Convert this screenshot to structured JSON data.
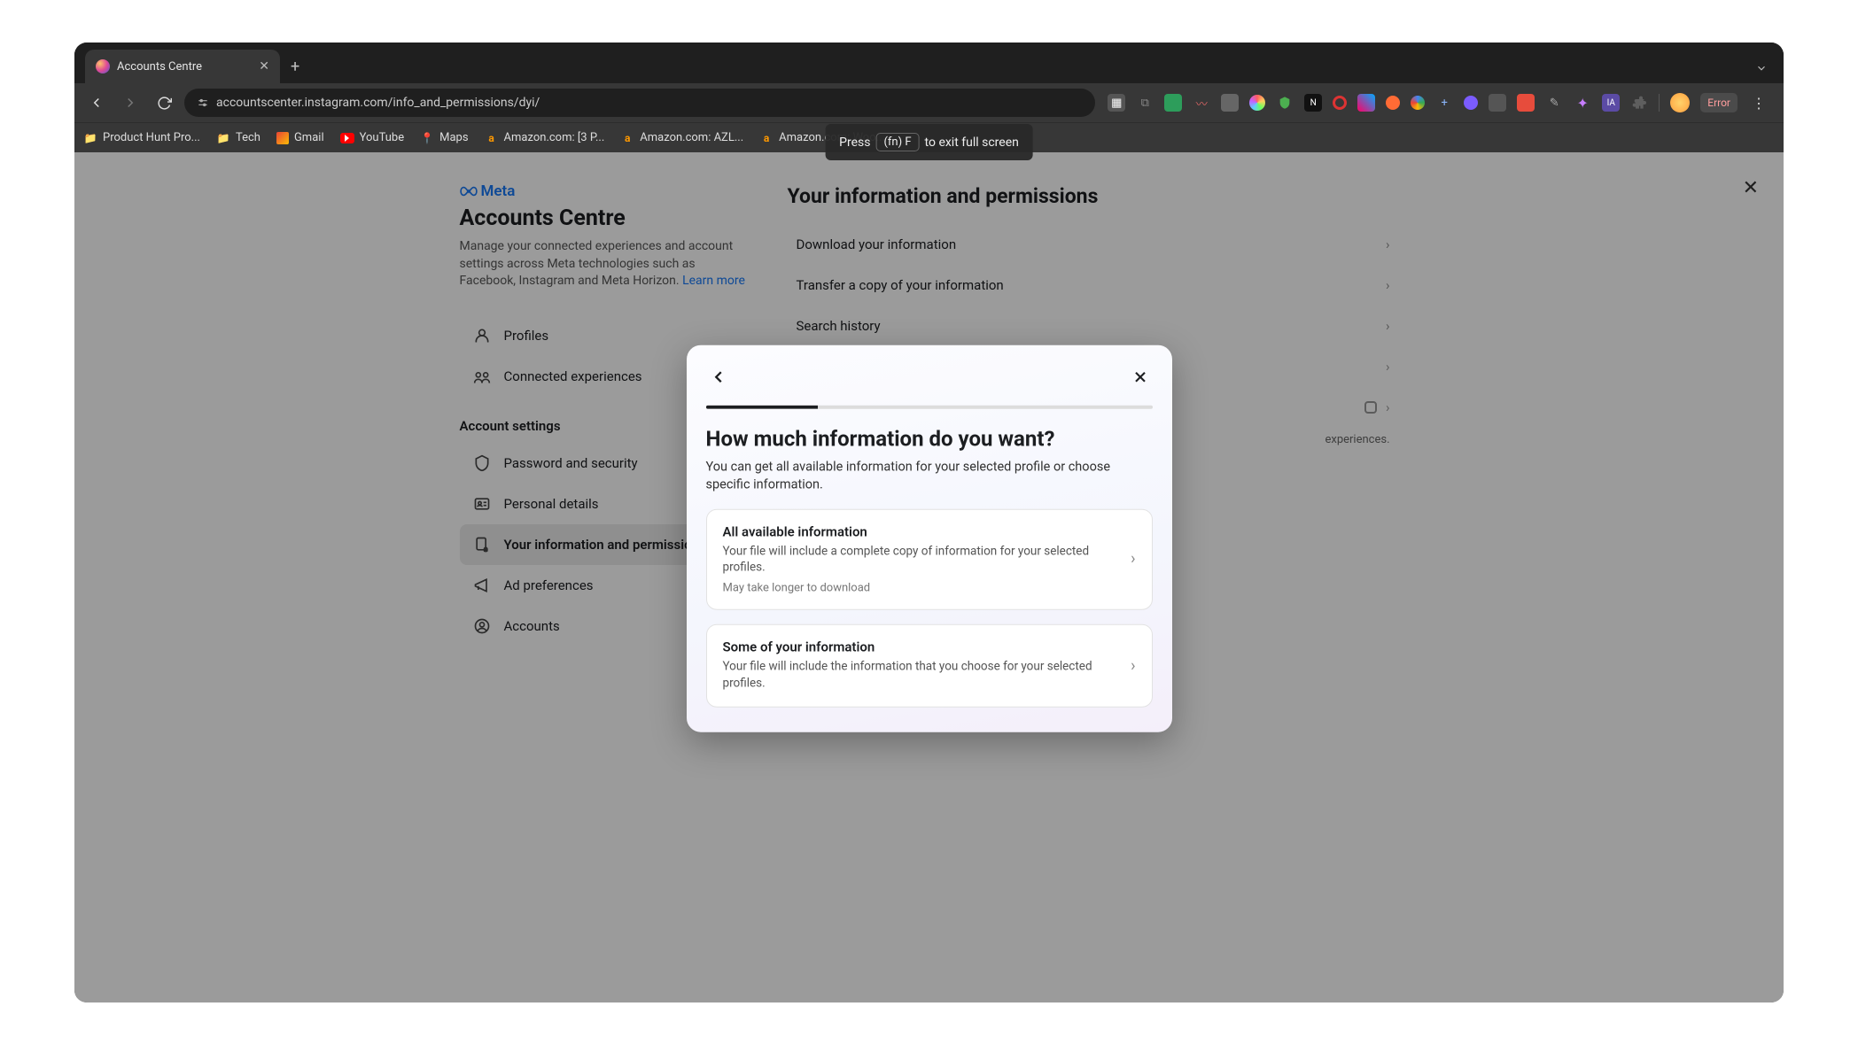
{
  "browser": {
    "tab_title": "Accounts Centre",
    "url": "accountscenter.instagram.com/info_and_permissions/dyi/",
    "error_label": "Error",
    "fs_hint_press": "Press",
    "fs_hint_key": "(fn) F",
    "fs_hint_rest": "to exit full screen"
  },
  "bookmarks": [
    {
      "label": "Product Hunt Pro..."
    },
    {
      "label": "Tech"
    },
    {
      "label": "Gmail"
    },
    {
      "label": "YouTube"
    },
    {
      "label": "Maps"
    },
    {
      "label": "Amazon.com: [3 P..."
    },
    {
      "label": "Amazon.com: AZL..."
    },
    {
      "label": "Amazon.com: Woo..."
    }
  ],
  "sidebar": {
    "brand": "Meta",
    "title": "Accounts Centre",
    "subtitle": "Manage your connected experiences and account settings across Meta technologies such as Facebook, Instagram and Meta Horizon.",
    "learn_more": "Learn more",
    "nav": [
      {
        "label": "Profiles"
      },
      {
        "label": "Connected experiences"
      }
    ],
    "section_label": "Account settings",
    "settings": [
      {
        "label": "Password and security"
      },
      {
        "label": "Personal details"
      },
      {
        "label": "Your information and permissions",
        "active": true
      },
      {
        "label": "Ad preferences"
      },
      {
        "label": "Accounts"
      }
    ]
  },
  "main": {
    "title": "Your information and permissions",
    "items": [
      {
        "label": "Download your information"
      },
      {
        "label": "Transfer a copy of your information"
      },
      {
        "label": "Search history"
      }
    ],
    "footer_tail": "experiences."
  },
  "modal": {
    "title": "How much information do you want?",
    "subtitle": "You can get all available information for your selected profile or choose specific information.",
    "options": [
      {
        "title": "All available information",
        "desc": "Your file will include a complete copy of information for your selected profiles.",
        "note": "May take longer to download"
      },
      {
        "title": "Some of your information",
        "desc": "Your file will include the information that you choose for your selected profiles."
      }
    ]
  }
}
